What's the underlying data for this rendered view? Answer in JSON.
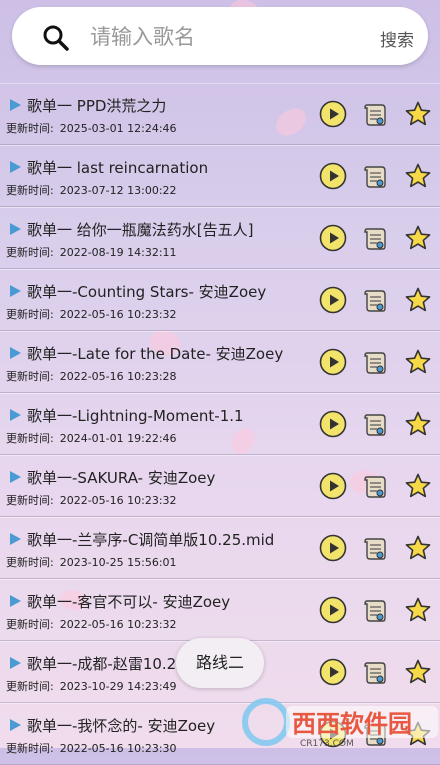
{
  "search": {
    "placeholder": "请输入歌名",
    "button_label": "搜索"
  },
  "time_prefix": "更新时间:",
  "songs": [
    {
      "title": "歌单一 PPD洪荒之力",
      "updated": "2025-03-01 12:24:46"
    },
    {
      "title": "歌单一 last reincarnation",
      "updated": "2023-07-12 13:00:22"
    },
    {
      "title": "歌单一 给你一瓶魔法药水[告五人]",
      "updated": "2022-08-19 14:32:11"
    },
    {
      "title": "歌单一-Counting Stars- 安迪Zoey",
      "updated": "2022-05-16 10:23:32"
    },
    {
      "title": "歌单一-Late for the Date- 安迪Zoey",
      "updated": "2022-05-16 10:23:28"
    },
    {
      "title": "歌单一-Lightning-Moment-1.1",
      "updated": "2024-01-01 19:22:46"
    },
    {
      "title": "歌单一-SAKURA- 安迪Zoey",
      "updated": "2022-05-16 10:23:32"
    },
    {
      "title": "歌单一-兰亭序-C调简单版10.25.mid",
      "updated": "2023-10-25 15:56:01"
    },
    {
      "title": "歌单一-客官不可以- 安迪Zoey",
      "updated": "2022-05-16 10:23:32"
    },
    {
      "title": "歌单一-成都-赵雷10.29",
      "updated": "2023-10-29 14:23:49"
    },
    {
      "title": "歌单一-我怀念的- 安迪Zoey",
      "updated": "2022-05-16 10:23:30"
    }
  ],
  "toast": {
    "text": "路线二"
  },
  "watermark": {
    "text": "西西软件园",
    "url": "CR173.COM"
  },
  "colors": {
    "play_yellow": "#f2e36a",
    "star_yellow": "#f7d948",
    "accent_blue": "#4a9ad4"
  }
}
